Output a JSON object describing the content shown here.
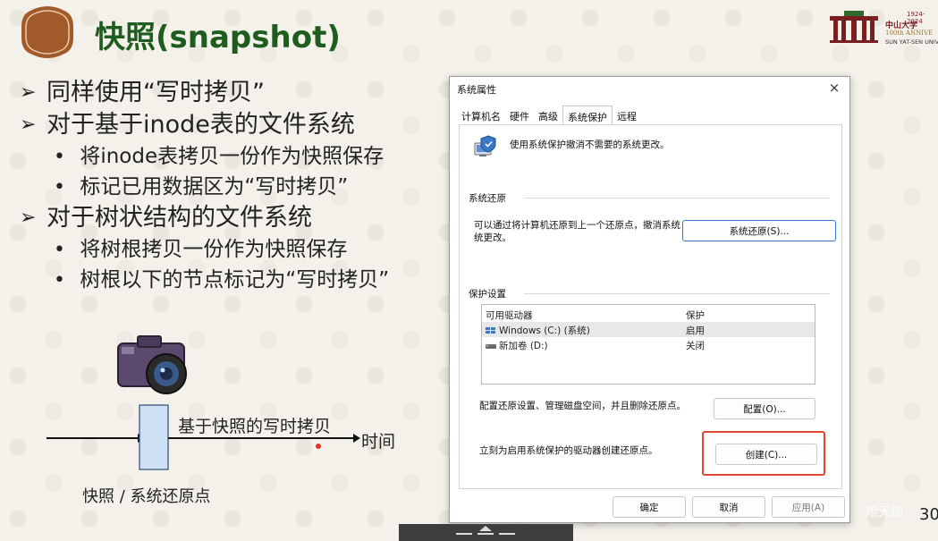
{
  "slide": {
    "title": "快照(snapshot)",
    "page_number": "30",
    "watermark": "暗天加"
  },
  "university": {
    "years": "1924-2024",
    "name_cn": "中山大学",
    "anniversary": "100th ANNIVE",
    "name_en": "SUN YAT-SEN UNIV"
  },
  "bullets": [
    {
      "text": "同样使用“写时拷贝”",
      "subs": []
    },
    {
      "text": "对于基于inode表的文件系统",
      "subs": [
        "将inode表拷贝一份作为快照保存",
        "标记已用数据区为“写时拷贝”"
      ]
    },
    {
      "text": "对于树状结构的文件系统",
      "subs": [
        "将树根拷贝一份作为快照保存",
        "树根以下的节点标记为“写时拷贝”"
      ]
    }
  ],
  "diagram": {
    "cow_label": "基于快照的写时拷贝",
    "time_label": "时间",
    "snapshot_label": "快照 / 系统还原点"
  },
  "dialog": {
    "title": "系统属性",
    "close_glyph": "×",
    "tabs": [
      {
        "label": "计算机名",
        "active": false
      },
      {
        "label": "硬件",
        "active": false
      },
      {
        "label": "高级",
        "active": false
      },
      {
        "label": "系统保护",
        "active": true
      },
      {
        "label": "远程",
        "active": false
      }
    ],
    "intro": "使用系统保护撤消不需要的系统更改。",
    "restore_section": "系统还原",
    "restore_desc_line1": "可以通过将计算机还原到上一个还原点，撤消系统",
    "restore_desc_line2": "统更改。",
    "restore_button": "系统还原(S)...",
    "protection_section": "保护设置",
    "drive_list": {
      "headers": [
        "可用驱动器",
        "保护"
      ],
      "rows": [
        {
          "name": "Windows (C:) (系统)",
          "protection": "启用",
          "selected": true
        },
        {
          "name": "新加卷 (D:)",
          "protection": "关闭",
          "selected": false
        }
      ]
    },
    "configure_desc": "配置还原设置、管理磁盘空间，并且删除还原点。",
    "configure_button": "配置(O)...",
    "create_desc": "立刻为启用系统保护的驱动器创建还原点。",
    "create_button": "创建(C)...",
    "ok_button": "确定",
    "cancel_button": "取消",
    "apply_button": "应用(A)"
  },
  "colors": {
    "title_green": "#1f5c1f",
    "logo_brown": "#a35a2a",
    "highlight_red": "#e4492f",
    "snapshot_box": "#cfe0f5"
  }
}
